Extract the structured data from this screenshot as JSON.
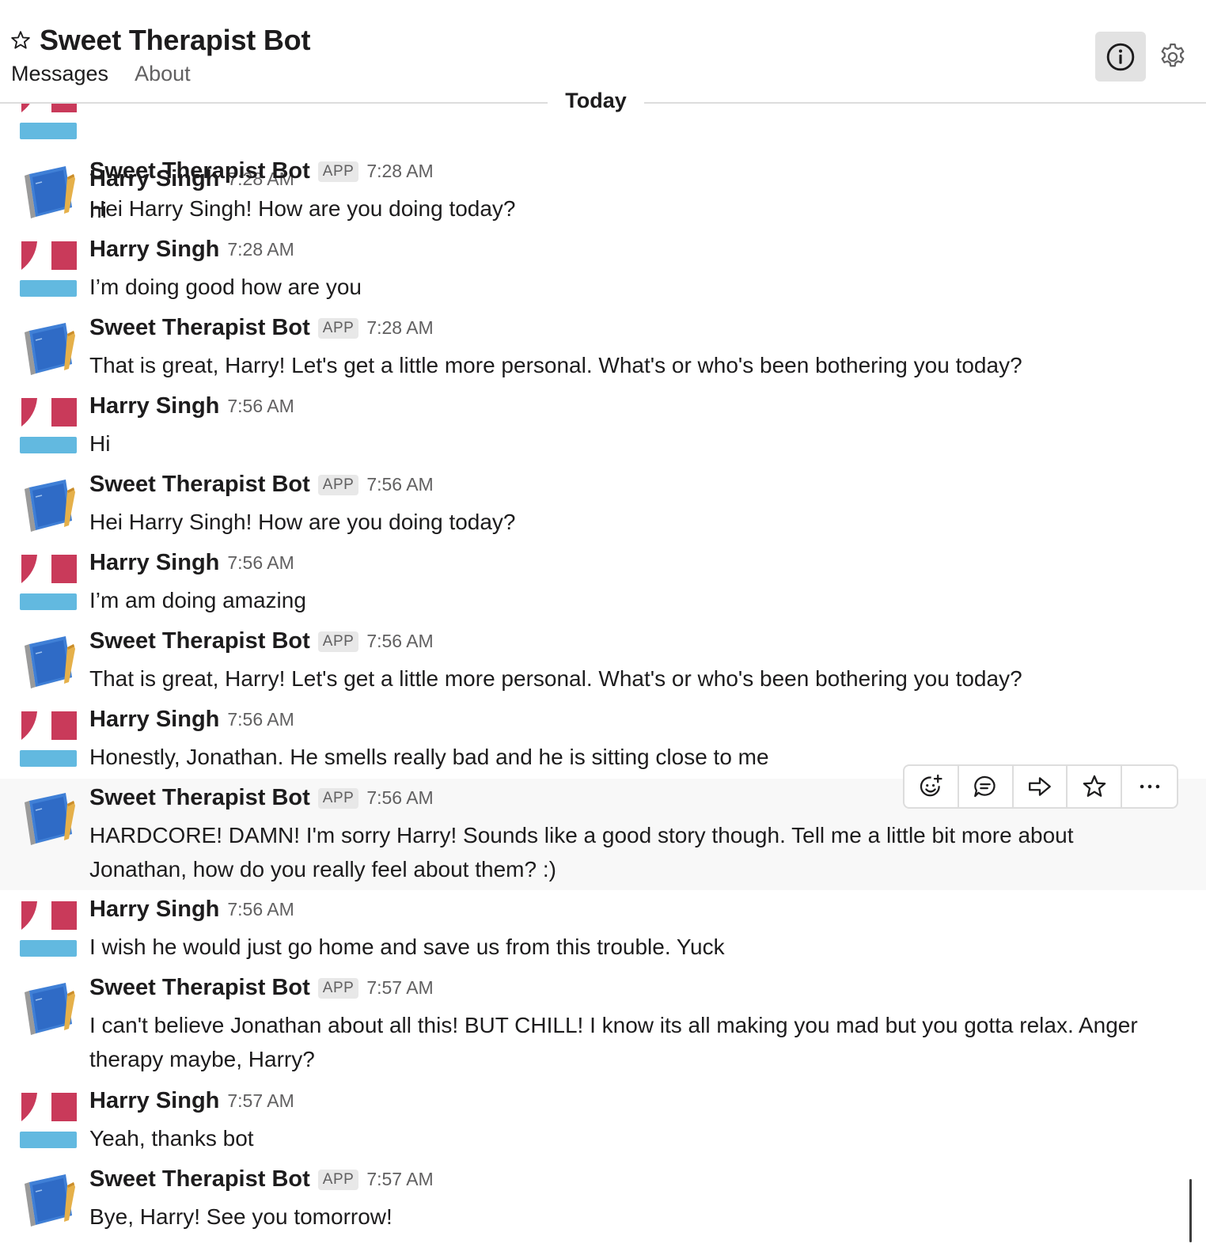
{
  "header": {
    "title": "Sweet Therapist Bot",
    "tabs": [
      {
        "label": "Messages"
      },
      {
        "label": "About"
      }
    ],
    "icons": {
      "star": "star-outline-icon",
      "info": "info-icon",
      "settings": "gear-icon"
    }
  },
  "divider": {
    "label": "Today"
  },
  "partial_message": {
    "sender": "Harry Singh",
    "time": "7:28 AM",
    "text": "hi"
  },
  "messages": [
    {
      "sender": "Sweet Therapist Bot",
      "badge": "APP",
      "time": "7:28 AM",
      "text": "Hei Harry Singh! How are you doing today?"
    },
    {
      "sender": "Harry Singh",
      "time": "7:28 AM",
      "text": "I’m doing good how are you"
    },
    {
      "sender": "Sweet Therapist Bot",
      "badge": "APP",
      "time": "7:28 AM",
      "text": "That is great, Harry! Let's get a little more personal. What's or who's been bothering you today?"
    },
    {
      "sender": "Harry Singh",
      "time": "7:56 AM",
      "text": "Hi"
    },
    {
      "sender": "Sweet Therapist Bot",
      "badge": "APP",
      "time": "7:56 AM",
      "text": "Hei Harry Singh! How are you doing today?"
    },
    {
      "sender": "Harry Singh",
      "time": "7:56 AM",
      "text": "I’m am doing amazing"
    },
    {
      "sender": "Sweet Therapist Bot",
      "badge": "APP",
      "time": "7:56 AM",
      "text": "That is great, Harry! Let's get a little more personal. What's or who's been bothering you today?"
    },
    {
      "sender": "Harry Singh",
      "time": "7:56 AM",
      "text": "Honestly, Jonathan. He smells really bad and he is sitting close to me"
    },
    {
      "sender": "Sweet Therapist Bot",
      "badge": "APP",
      "time": "7:56 AM",
      "text": "HARDCORE! DAMN! I'm sorry Harry! Sounds like a good story though. Tell me a little bit more about Jonathan, how do you really feel about them? :)"
    },
    {
      "sender": "Harry Singh",
      "time": "7:56 AM",
      "text": "I wish he would just go home and save us from this trouble. Yuck"
    },
    {
      "sender": "Sweet Therapist Bot",
      "badge": "APP",
      "time": "7:57 AM",
      "text": "I can't believe Jonathan about all this! BUT CHILL! I know its all making you mad but you gotta relax. Anger therapy maybe, Harry?"
    },
    {
      "sender": "Harry Singh",
      "time": "7:57 AM",
      "text": "Yeah, thanks bot"
    },
    {
      "sender": "Sweet Therapist Bot",
      "badge": "APP",
      "time": "7:57 AM",
      "text": "Bye, Harry! See you tomorrow!"
    }
  ],
  "hover_actions": [
    "add-reaction-icon",
    "reply-thread-icon",
    "share-icon",
    "star-icon",
    "more-actions-icon"
  ]
}
